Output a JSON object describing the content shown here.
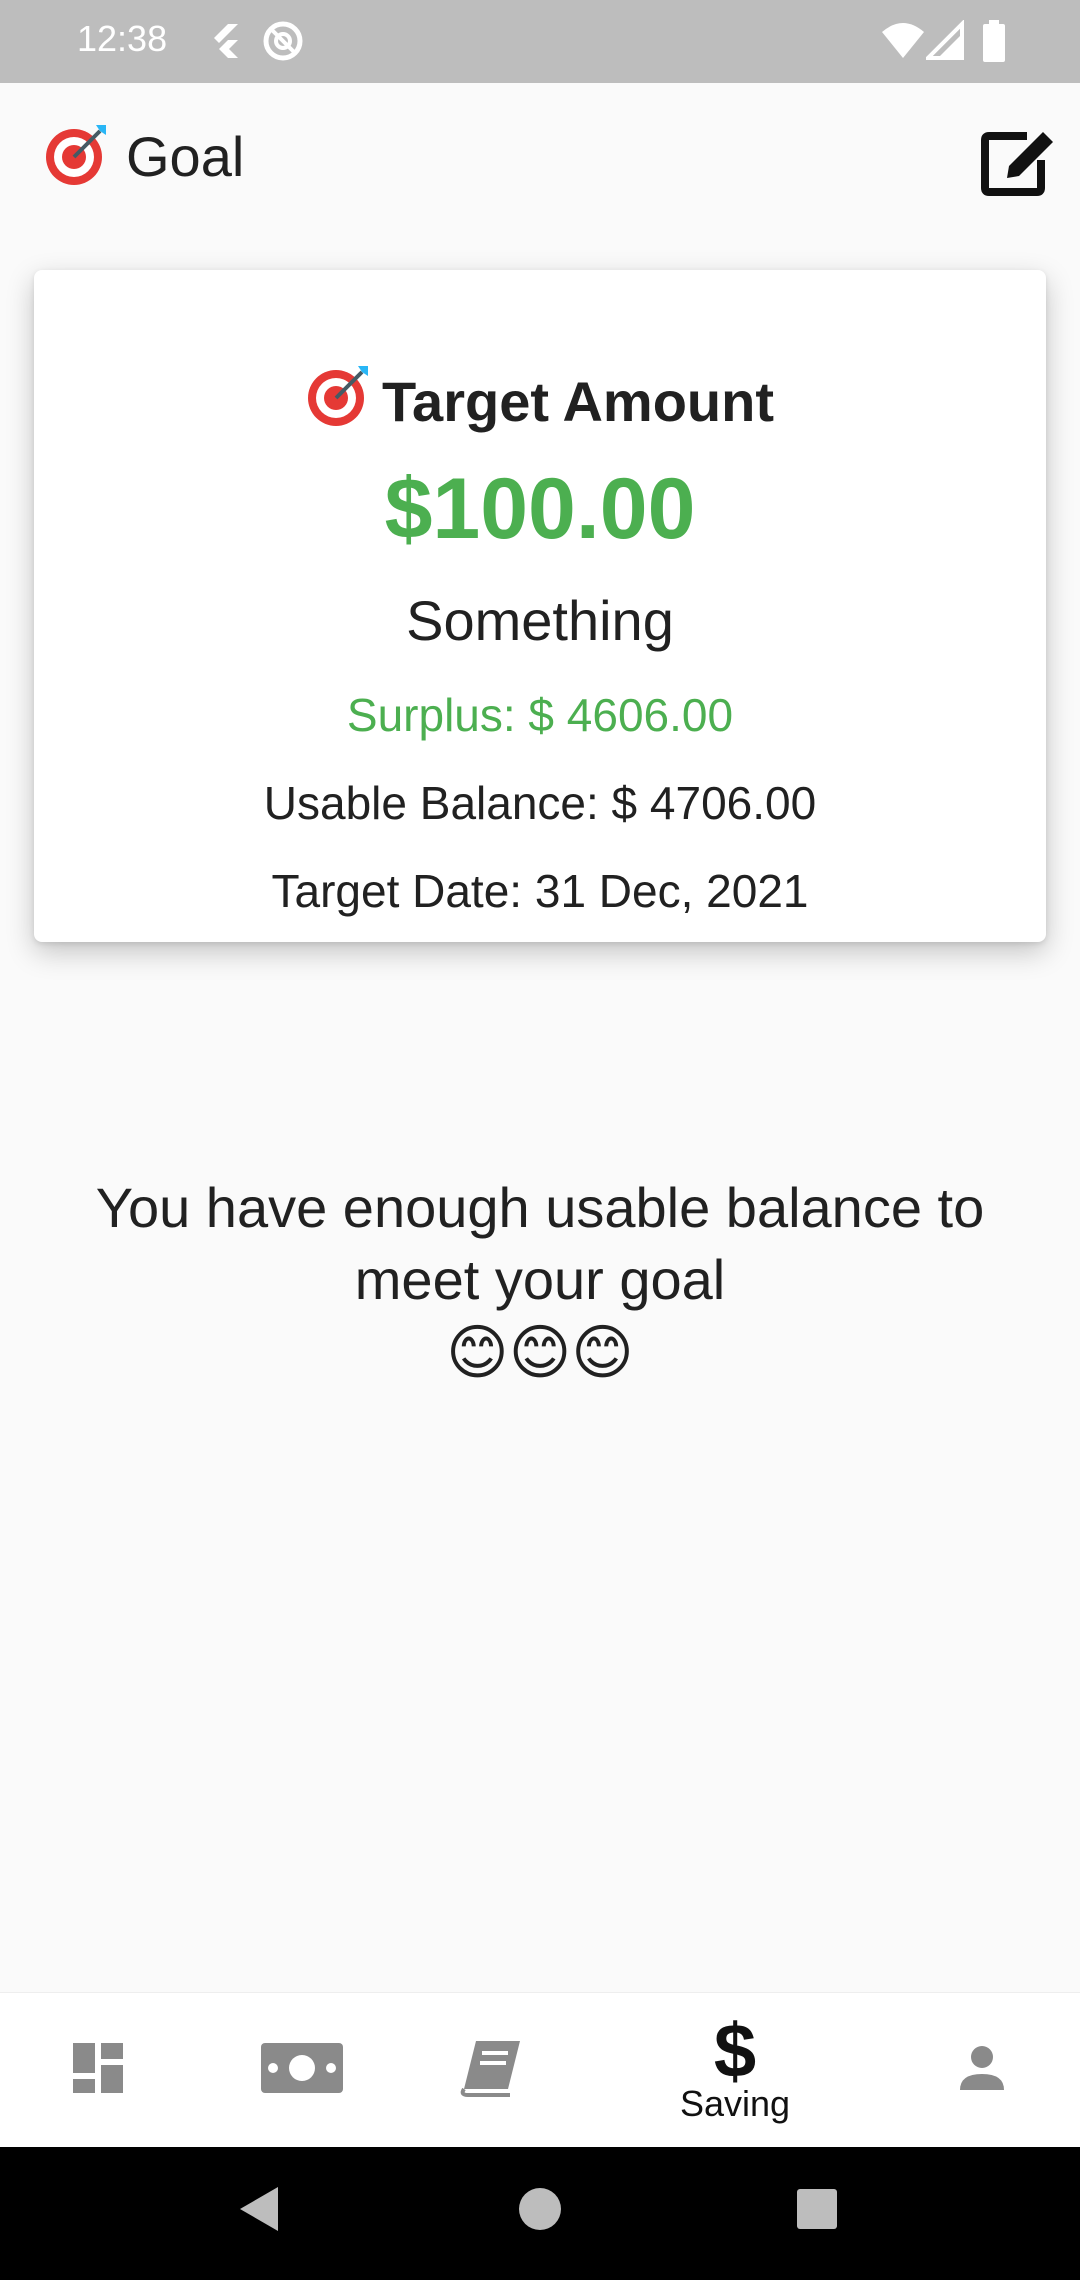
{
  "status_bar": {
    "time": "12:38"
  },
  "app_bar": {
    "title": "Goal",
    "edit_icon": "edit-square-icon"
  },
  "card": {
    "heading": "Target Amount",
    "amount": "$100.00",
    "goal_name": "Something",
    "surplus": "Surplus: $ 4606.00",
    "usable_balance": "Usable Balance: $ 4706.00",
    "target_date": "Target Date: 31 Dec, 2021"
  },
  "message": {
    "text": "You have enough usable balance to meet your goal",
    "emojis": "😊😊😊"
  },
  "bottom_nav": {
    "items": [
      {
        "icon": "dashboard-icon",
        "label": ""
      },
      {
        "icon": "money-icon",
        "label": ""
      },
      {
        "icon": "book-icon",
        "label": ""
      },
      {
        "icon": "dollar-icon",
        "label": "Saving",
        "active": true
      },
      {
        "icon": "person-icon",
        "label": ""
      }
    ]
  },
  "colors": {
    "accent_green": "#4caf50",
    "status_bar": "#bdbdbd",
    "nav_inactive": "#8a8a8a"
  }
}
